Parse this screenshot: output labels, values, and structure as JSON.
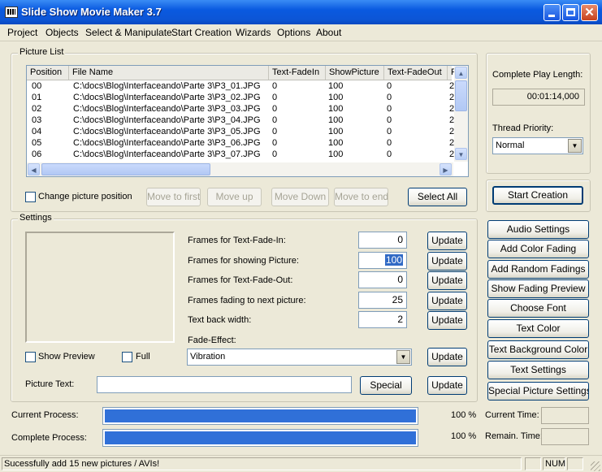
{
  "window": {
    "title": "Slide Show Movie Maker 3.7"
  },
  "menu": [
    "Project",
    "Objects",
    "Select & Manipulate",
    "Start Creation",
    "Wizards",
    "Options",
    "About"
  ],
  "picture_list": {
    "legend": "Picture List",
    "columns": [
      "Position",
      "File Name",
      "Text-FadeIn",
      "ShowPicture",
      "Text-FadeOut",
      "F"
    ],
    "rows": [
      {
        "position": "00",
        "file": "C:\\docs\\Blog\\Interfaceando\\Parte 3\\P3_01.JPG",
        "fadein": "0",
        "show": "100",
        "fadeout": "0",
        "f": "2"
      },
      {
        "position": "01",
        "file": "C:\\docs\\Blog\\Interfaceando\\Parte 3\\P3_02.JPG",
        "fadein": "0",
        "show": "100",
        "fadeout": "0",
        "f": "2"
      },
      {
        "position": "02",
        "file": "C:\\docs\\Blog\\Interfaceando\\Parte 3\\P3_03.JPG",
        "fadein": "0",
        "show": "100",
        "fadeout": "0",
        "f": "2"
      },
      {
        "position": "03",
        "file": "C:\\docs\\Blog\\Interfaceando\\Parte 3\\P3_04.JPG",
        "fadein": "0",
        "show": "100",
        "fadeout": "0",
        "f": "2"
      },
      {
        "position": "04",
        "file": "C:\\docs\\Blog\\Interfaceando\\Parte 3\\P3_05.JPG",
        "fadein": "0",
        "show": "100",
        "fadeout": "0",
        "f": "2"
      },
      {
        "position": "05",
        "file": "C:\\docs\\Blog\\Interfaceando\\Parte 3\\P3_06.JPG",
        "fadein": "0",
        "show": "100",
        "fadeout": "0",
        "f": "2"
      },
      {
        "position": "06",
        "file": "C:\\docs\\Blog\\Interfaceando\\Parte 3\\P3_07.JPG",
        "fadein": "0",
        "show": "100",
        "fadeout": "0",
        "f": "2"
      }
    ],
    "change_position_label": "Change picture position",
    "buttons": {
      "move_first": "Move to first",
      "move_up": "Move up",
      "move_down": "Move Down",
      "move_end": "Move to end",
      "select_all": "Select All"
    }
  },
  "settings": {
    "legend": "Settings",
    "fields": [
      {
        "label": "Frames for Text-Fade-In:",
        "value": "0"
      },
      {
        "label": "Frames for showing Picture:",
        "value": "100"
      },
      {
        "label": "Frames for Text-Fade-Out:",
        "value": "0"
      },
      {
        "label": "Frames fading to next picture:",
        "value": "25"
      },
      {
        "label": "Text back width:",
        "value": "2"
      }
    ],
    "update_label": "Update",
    "fade_effect_label": "Fade-Effect:",
    "fade_effect_value": "Vibration",
    "show_preview_label": "Show Preview",
    "full_label": "Full",
    "picture_text_label": "Picture Text:",
    "picture_text_value": "",
    "special_label": "Special"
  },
  "right": {
    "play_length_label": "Complete Play Length:",
    "play_length_value": "00:01:14,000",
    "thread_priority_label": "Thread Priority:",
    "thread_priority_value": "Normal",
    "start_creation": "Start Creation",
    "buttons": [
      "Audio Settings",
      "Add Color Fading",
      "Add Random Fadings",
      "Show Fading Preview",
      "Choose Font",
      "Text Color",
      "Text Background Color",
      "Text Settings",
      "Special Picture Settings"
    ]
  },
  "progress": {
    "current_label": "Current Process:",
    "complete_label": "Complete Process:",
    "current_value": 100,
    "complete_value": 100,
    "current_text": "100 %",
    "complete_text": "100 %",
    "current_time_label": "Current Time:",
    "remain_time_label": "Remain. Time:",
    "current_time_value": "",
    "remain_time_value": ""
  },
  "status": {
    "message": "Sucessfully add 15 new pictures / AVIs!",
    "num": "NUM"
  }
}
